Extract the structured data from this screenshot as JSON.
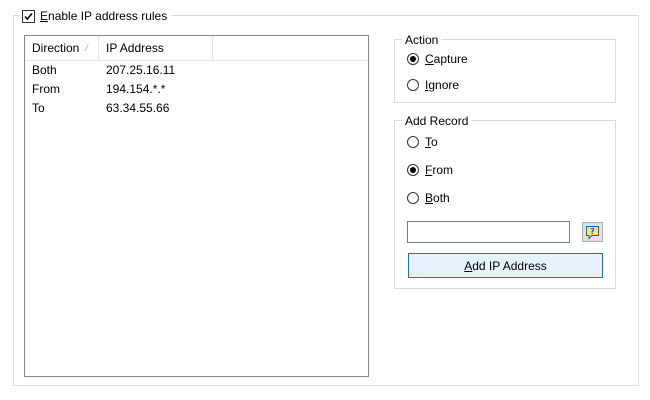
{
  "enable_rules": {
    "label_first": "E",
    "label_rest": "nable IP address rules",
    "checked": true
  },
  "list": {
    "columns": [
      "Direction",
      "IP Address"
    ],
    "sort_indicator": "⁄",
    "rows": [
      {
        "direction": "Both",
        "ip": "207.25.16.11"
      },
      {
        "direction": "From",
        "ip": "194.154.*.*"
      },
      {
        "direction": "To",
        "ip": "63.34.55.66"
      }
    ]
  },
  "action": {
    "title": "Action",
    "options": [
      {
        "first": "C",
        "rest": "apture",
        "checked": true
      },
      {
        "first": "I",
        "rest": "gnore",
        "checked": false
      }
    ]
  },
  "add_record": {
    "title": "Add Record",
    "options": [
      {
        "first": "T",
        "rest": "o",
        "checked": false
      },
      {
        "first": "F",
        "rest": "rom",
        "checked": true
      },
      {
        "first": "B",
        "rest": "oth",
        "checked": false
      }
    ],
    "ip_value": "",
    "button_first": "A",
    "button_rest": "dd IP Address"
  },
  "colors": {
    "accent_border": "#0078d7",
    "button_face": "#e5f1fb",
    "icon_blue": "#1f5fbf",
    "icon_yellow": "#f7e27a"
  },
  "icons": {
    "lookup": "help-balloon-icon"
  }
}
